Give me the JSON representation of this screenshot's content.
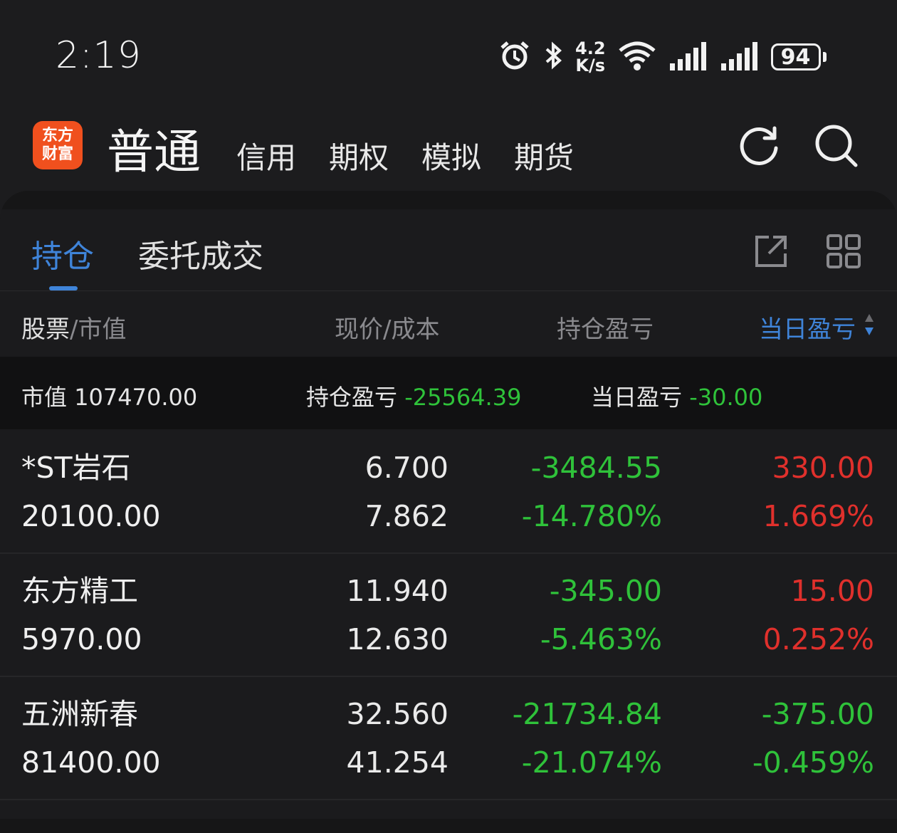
{
  "status_bar": {
    "time": "2:19",
    "net_speed_value": "4.2",
    "net_speed_unit": "K/s",
    "battery": "94",
    "icons": [
      "alarm-icon",
      "bluetooth-icon",
      "wifi-icon",
      "signal-icon",
      "signal-icon",
      "battery-icon"
    ]
  },
  "header": {
    "logo_line1": "东方",
    "logo_line2": "财富",
    "tabs": [
      {
        "label": "普通"
      },
      {
        "label": "信用"
      },
      {
        "label": "期权"
      },
      {
        "label": "模拟"
      },
      {
        "label": "期货"
      }
    ],
    "icons": [
      "refresh-icon",
      "search-icon"
    ]
  },
  "sub_tabs": {
    "holding": "持仓",
    "orders": "委托成交",
    "icons": [
      "share-icon",
      "grid-icon"
    ]
  },
  "columns": {
    "stock_a": "股票",
    "stock_b": "/市值",
    "price_cost": "现价/成本",
    "holding_pl": "持仓盈亏",
    "day_pl": "当日盈亏"
  },
  "summary": {
    "market_value_label": "市值",
    "market_value": "107470.00",
    "holding_pl_label": "持仓盈亏",
    "holding_pl": "-25564.39",
    "day_pl_label": "当日盈亏",
    "day_pl": "-30.00"
  },
  "positions": [
    {
      "name": "*ST岩石",
      "market_value": "20100.00",
      "price": "6.700",
      "cost": "7.862",
      "holding_pl": "-3484.55",
      "holding_pl_pct": "-14.780%",
      "day_pl": "330.00",
      "day_pl_pct": "1.669%"
    },
    {
      "name": "东方精工",
      "market_value": "5970.00",
      "price": "11.940",
      "cost": "12.630",
      "holding_pl": "-345.00",
      "holding_pl_pct": "-5.463%",
      "day_pl": "15.00",
      "day_pl_pct": "0.252%"
    },
    {
      "name": "五洲新春",
      "market_value": "81400.00",
      "price": "32.560",
      "cost": "41.254",
      "holding_pl": "-21734.84",
      "holding_pl_pct": "-21.074%",
      "day_pl": "-375.00",
      "day_pl_pct": "-0.459%"
    }
  ],
  "colors": {
    "accent": "#3f84d9",
    "gain": "#e0302c",
    "loss": "#2fc23a",
    "brand": "#f0501e"
  }
}
